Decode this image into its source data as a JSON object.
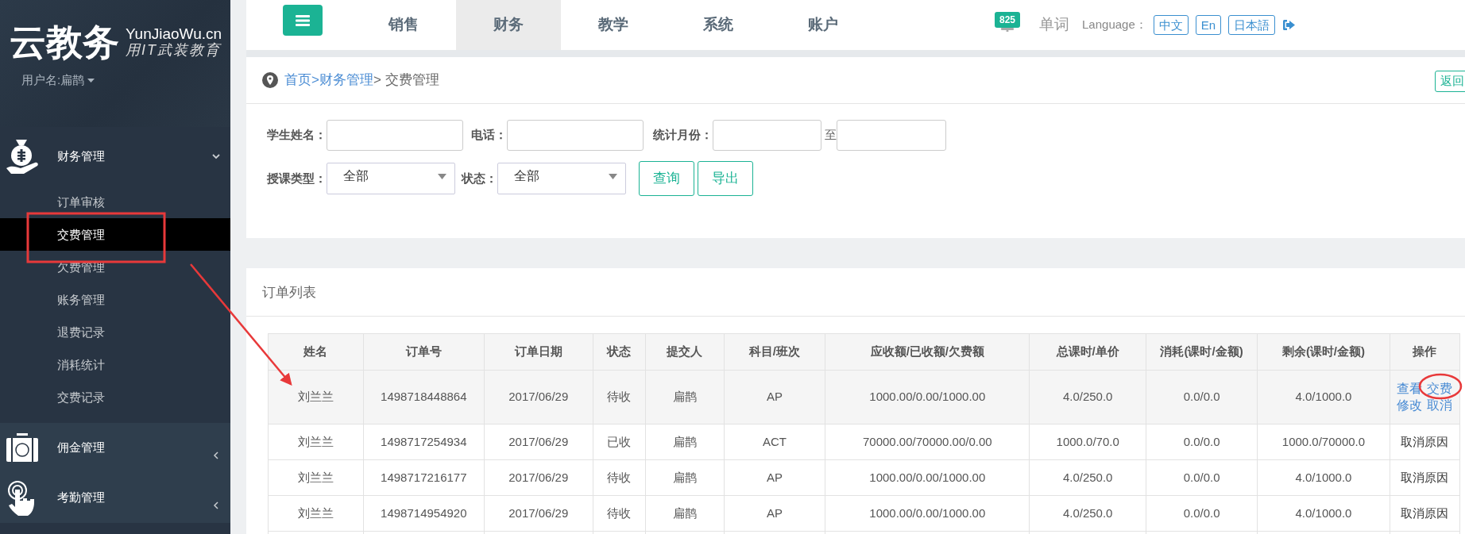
{
  "sidebar": {
    "logo": {
      "title": "云教务",
      "domain": "YunJiaoWu.cn",
      "slogan": "用IT武装教育"
    },
    "user": "用户名:扁鹊",
    "menu": [
      {
        "label": "财务管理",
        "expanded": true,
        "children": [
          {
            "label": "订单审核",
            "selected": false
          },
          {
            "label": "交费管理",
            "selected": true
          },
          {
            "label": "欠费管理",
            "selected": false
          },
          {
            "label": "账务管理",
            "selected": false
          },
          {
            "label": "退费记录",
            "selected": false
          },
          {
            "label": "消耗统计",
            "selected": false
          },
          {
            "label": "交费记录",
            "selected": false
          }
        ]
      },
      {
        "label": "佣金管理",
        "expanded": false
      },
      {
        "label": "考勤管理",
        "expanded": false
      }
    ]
  },
  "topbar": {
    "tabs": [
      {
        "label": "销售",
        "selected": false
      },
      {
        "label": "财务",
        "selected": true
      },
      {
        "label": "教学",
        "selected": false
      },
      {
        "label": "系统",
        "selected": false
      },
      {
        "label": "账户",
        "selected": false
      }
    ],
    "badge": "825",
    "words": "单词",
    "language_label": "Language：",
    "languages": [
      "中文",
      "En",
      "日本語"
    ]
  },
  "breadcrumb": {
    "links": [
      "首页",
      ">财务管理"
    ],
    "current": "> 交费管理",
    "back": "返回"
  },
  "filters": {
    "student_label": "学生姓名：",
    "phone_label": "电话：",
    "month_label": "统计月份：",
    "month_to": "至",
    "type_label": "授课类型：",
    "type_value": "全部",
    "status_label": "状态：",
    "status_value": "全部",
    "buttons": [
      "查询",
      "导出"
    ]
  },
  "orders": {
    "title": "订单列表",
    "columns": [
      "姓名",
      "订单号",
      "订单日期",
      "状态",
      "提交人",
      "科目/班次",
      "应收额/已收额/欠费额",
      "总课时/单价",
      "消耗(课时/金额)",
      "剩余(课时/金额)",
      "操作"
    ],
    "rows": [
      {
        "selected": true,
        "cells": [
          "刘兰兰",
          "1498718448864",
          "2017/06/29",
          "待收",
          "扁鹊",
          "AP",
          "1000.00/0.00/1000.00",
          "4.0/250.0",
          "0.0/0.0",
          "4.0/1000.0"
        ],
        "actions": [
          {
            "kind": "link",
            "label": "查看"
          },
          {
            "kind": "link",
            "label": "交费"
          },
          {
            "kind": "link",
            "label": "修改"
          },
          {
            "kind": "link",
            "label": "取消"
          }
        ]
      },
      {
        "selected": false,
        "cells": [
          "刘兰兰",
          "1498717254934",
          "2017/06/29",
          "已收",
          "扁鹊",
          "ACT",
          "70000.00/70000.00/0.00",
          "1000.0/70.0",
          "0.0/0.0",
          "1000.0/70000.0"
        ],
        "actions": [
          {
            "kind": "text",
            "label": "取消原因"
          }
        ]
      },
      {
        "selected": false,
        "cells": [
          "刘兰兰",
          "1498717216177",
          "2017/06/29",
          "待收",
          "扁鹊",
          "AP",
          "1000.00/0.00/1000.00",
          "4.0/250.0",
          "0.0/0.0",
          "4.0/1000.0"
        ],
        "actions": [
          {
            "kind": "text",
            "label": "取消原因"
          }
        ]
      },
      {
        "selected": false,
        "cells": [
          "刘兰兰",
          "1498714954920",
          "2017/06/29",
          "待收",
          "扁鹊",
          "AP",
          "1000.00/0.00/1000.00",
          "4.0/250.0",
          "0.0/0.0",
          "4.0/1000.0"
        ],
        "actions": [
          {
            "kind": "text",
            "label": "取消原因"
          }
        ]
      }
    ]
  }
}
